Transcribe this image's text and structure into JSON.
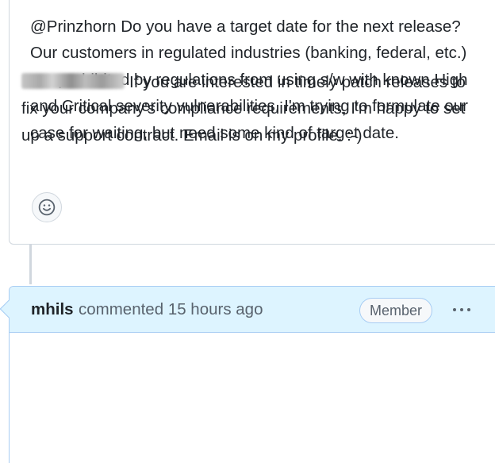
{
  "first_comment": {
    "body": "@Prinzhorn Do you have a target date for the next release? Our customers in regulated industries (banking, federal, etc.) are prohibited by regulations from using s/w with known High and Critical severity vulnerabilities. I'm trying to formulate our case for waiting, but need some kind of target date.",
    "reaction_icon": "smiley-icon"
  },
  "second_comment": {
    "author": "mhils",
    "action": "commented",
    "timestamp": "15 hours ago",
    "badge": "Member",
    "menu_icon": "kebab-horizontal-icon",
    "body": "If you are interested in timely patch releases to fix your company's compliance requirements, I'm happy to set up a support contract. Email is on my profile. :-)"
  },
  "colors": {
    "header_bg": "#ddf4ff",
    "header_border": "#a8cdf3",
    "border": "#d0d7de",
    "muted_text": "#59636e"
  }
}
